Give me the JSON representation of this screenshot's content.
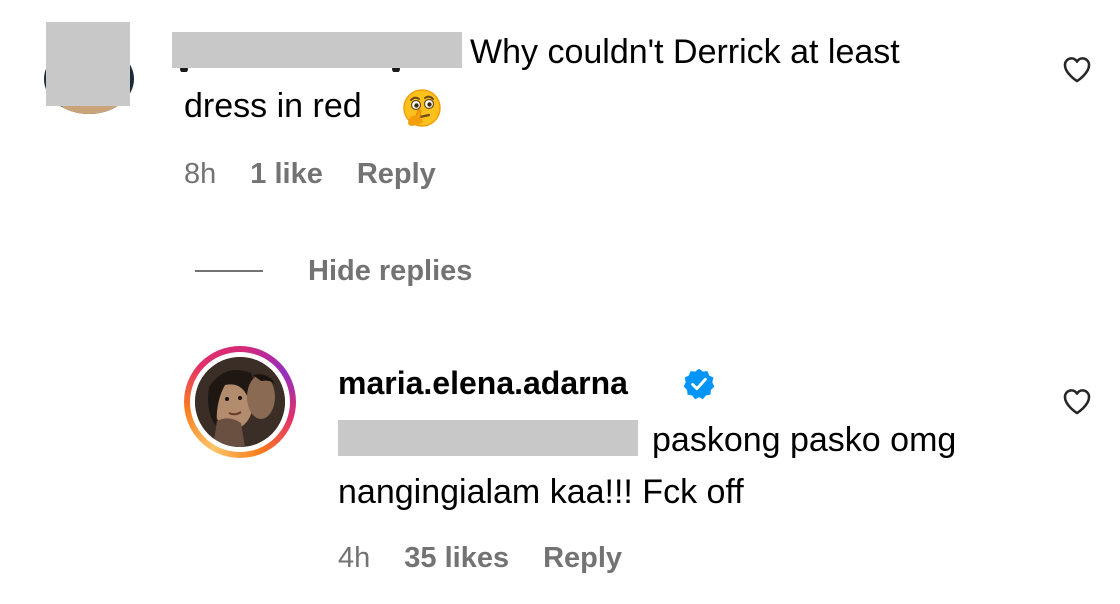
{
  "comments": [
    {
      "text_line1": "Why couldn't Derrick at least",
      "text_line2": "dress in red",
      "emoji": "thinking-face-with-raised-eyebrow",
      "time": "8h",
      "likes": "1 like",
      "reply_label": "Reply"
    },
    {
      "username": "maria.elena.adarna",
      "verified": true,
      "text_line1": "paskong pasko omg",
      "text_line2": "nangingialam kaa!!! Fck off",
      "time": "4h",
      "likes": "35 likes",
      "reply_label": "Reply"
    }
  ],
  "thread": {
    "hide_replies_label": "Hide replies"
  },
  "colors": {
    "meta_gray": "#737373",
    "redaction_gray": "#c8c8c8",
    "verified_blue": "#0095f6",
    "text": "#000000"
  },
  "icons": {
    "like": "heart-outline-icon",
    "verified": "verified-badge-icon"
  }
}
